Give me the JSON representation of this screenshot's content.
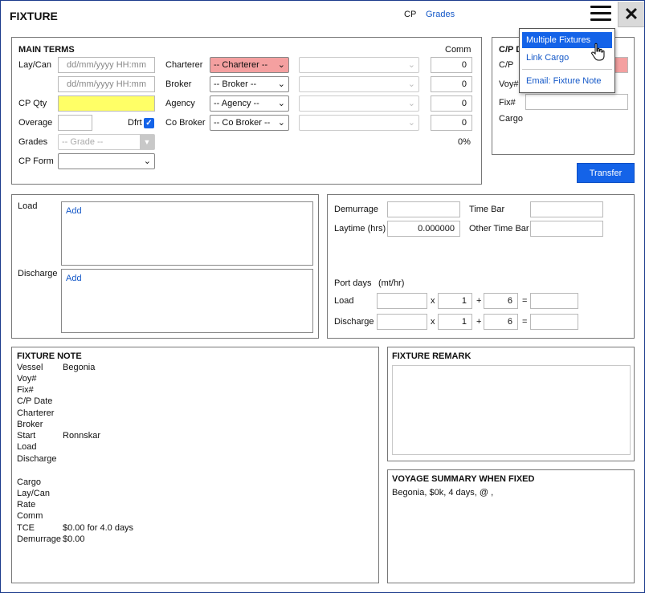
{
  "header": {
    "title": "FIXTURE",
    "cp_label": "CP",
    "grades_link": "Grades"
  },
  "menu": {
    "items": [
      "Multiple Fixtures",
      "Link Cargo",
      "Email: Fixture Note"
    ]
  },
  "main_terms": {
    "title": "MAIN TERMS",
    "comm_header": "Comm",
    "laycan_label": "Lay/Can",
    "laycan_from_placeholder": "dd/mm/yyyy HH:mm",
    "laycan_to_placeholder": "dd/mm/yyyy HH:mm",
    "cpqty_label": "CP Qty",
    "overage_label": "Overage",
    "dfrt_label": "Dfrt",
    "grades_label": "Grades",
    "grades_select": "-- Grade --",
    "cpform_label": "CP Form",
    "charterer_label": "Charterer",
    "charterer_select": "-- Charterer --",
    "broker_label": "Broker",
    "broker_select": "-- Broker --",
    "agency_label": "Agency",
    "agency_select": "-- Agency --",
    "cobroker_label": "Co Broker",
    "cobroker_select": "-- Co Broker --",
    "comm_values": [
      "0",
      "0",
      "0",
      "0"
    ],
    "comm_total": "0%"
  },
  "cp_details": {
    "title_visible": "C/P D",
    "cp_label": "C/P",
    "voy_label": "Voy#",
    "fix_label": "Fix#",
    "cargo_label": "Cargo",
    "transfer_button": "Transfer"
  },
  "ports": {
    "load_label": "Load",
    "discharge_label": "Discharge",
    "add_load": "Add",
    "add_discharge": "Add"
  },
  "demurrage": {
    "demurrage_label": "Demurrage",
    "laytime_label": "Laytime (hrs)",
    "laytime_value": "0.000000",
    "timebar_label": "Time Bar",
    "other_timebar_label": "Other Time Bar",
    "portdays_label": "Port days",
    "portdays_unit": "(mt/hr)",
    "load_label": "Load",
    "discharge_label": "Discharge",
    "x_symbol": "x",
    "plus_symbol": "+",
    "eq_symbol": "=",
    "load_mult": "1",
    "load_add": "6",
    "discharge_mult": "1",
    "discharge_add": "6"
  },
  "fixture_note": {
    "title": "FIXTURE NOTE",
    "rows": [
      {
        "label": "Vessel",
        "value": "Begonia"
      },
      {
        "label": "Voy#",
        "value": ""
      },
      {
        "label": "Fix#",
        "value": ""
      },
      {
        "label": "C/P Date",
        "value": ""
      },
      {
        "label": "Charterer",
        "value": ""
      },
      {
        "label": "Broker",
        "value": ""
      },
      {
        "label": "Start",
        "value": "Ronnskar"
      },
      {
        "label": "Load",
        "value": ""
      },
      {
        "label": "Discharge",
        "value": ""
      },
      {
        "label": "Cargo",
        "value": ""
      },
      {
        "label": "Lay/Can",
        "value": ""
      },
      {
        "label": "Rate",
        "value": ""
      },
      {
        "label": "Comm",
        "value": ""
      },
      {
        "label": "TCE",
        "value": "$0.00 for 4.0 days"
      },
      {
        "label": "Demurrage",
        "value": "$0.00"
      }
    ]
  },
  "fixture_remark": {
    "title": "FIXTURE REMARK"
  },
  "voyage_summary": {
    "title": "VOYAGE SUMMARY WHEN FIXED",
    "text": "Begonia, $0k, 4 days, @ ,"
  },
  "colors": {
    "accent": "#1463e8",
    "charterer_error": "#f4a0a0",
    "cpqty_highlight": "#ffff66",
    "link": "#1458c8"
  }
}
